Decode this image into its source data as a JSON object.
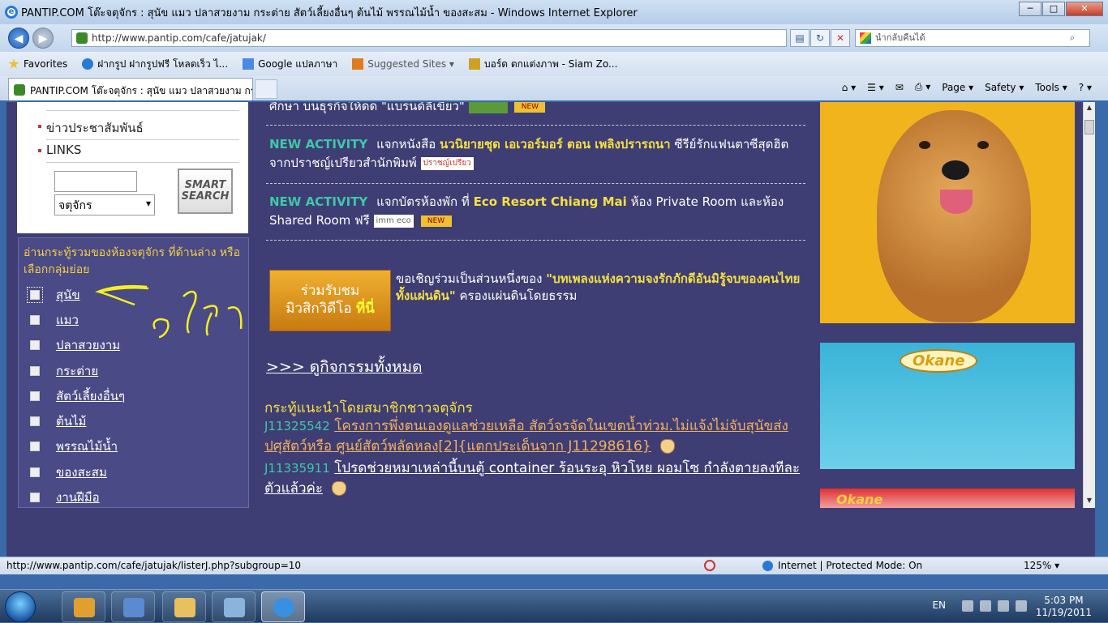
{
  "window": {
    "title": "PANTIP.COM โต๊ะจตุจักร : สุนัข แมว ปลาสวยงาม กระต่าย สัตว์เลี้ยงอื่นๆ ต้นไม้ พรรณไม้น้ำ ของสะสม - Windows Internet Explorer",
    "ie_glyph": "e",
    "minimize_glyph": "─",
    "maximize_glyph": "□",
    "close_glyph": "✕"
  },
  "nav": {
    "back_glyph": "◀",
    "forward_glyph": "▶",
    "url": "http://www.pantip.com/cafe/jatujak/",
    "search_placeholder": "นำกลับคืนได้",
    "compat_glyph": "▤",
    "refresh_glyph": "↻",
    "stop_glyph": "✕",
    "search_glyph": "⌕"
  },
  "favorites_bar": {
    "favorites_label": "Favorites",
    "items": [
      {
        "label": "ฝากรูป ฝากรูปฟรี โหลดเร็ว ไ...",
        "color": "#2a7ad4"
      },
      {
        "label": "Google แปลภาษา",
        "color": "#4a8ae0"
      },
      {
        "label": "Suggested Sites ▾",
        "color": "#e07a20"
      },
      {
        "label": "บอร์ด ตกแต่งภาพ - Siam Zo...",
        "color": "#d0a020"
      }
    ]
  },
  "tab": {
    "label": "PANTIP.COM โต๊ะจตุจักร : สุนัข แมว ปลาสวยงาม กระ..."
  },
  "command_bar": {
    "home": "⌂ ▾",
    "feeds": "☰ ▾",
    "mail": "✉",
    "print": "⎙ ▾",
    "page": "Page ▾",
    "safety": "Safety ▾",
    "tools": "Tools ▾",
    "help": "? ▾"
  },
  "left_panel": {
    "links": [
      "ข่าวประชาสัมพันธ์",
      "LINKS"
    ],
    "search_select": "จตุจักร",
    "smart_search_label": "SMART SEARCH"
  },
  "categories": {
    "heading": "อ่านกระทู้รวมของห้องจตุจักร ที่ด้านล่าง หรือเลือกกลุ่มย่อย",
    "items": [
      "สุนัข",
      "แมว",
      "ปลาสวยงาม",
      "กระต่าย",
      "สัตว์เลี้ยงอื่นๆ",
      "ต้นไม้",
      "พรรณไม้น้ำ",
      "ของสะสม",
      "งานฝีมือ"
    ]
  },
  "activities": {
    "top_partial": "ศึกษา บนธุรกิจให้ดด \"แบรนด์ลีเขียว\"",
    "new_badge": "NEW",
    "items": [
      {
        "label": "NEW ACTIVITY",
        "text_before": "แจกหนังสือ",
        "highlight": "นวนิยายชุด เอเวอร์มอร์ ตอน เพลิงปรารถนา",
        "text_after": "ซีรีย์รักแฟนตาซีสุดฮิต จากปราชญ์เปรียวสำนักพิมพ์",
        "logo": "ปราชญ์เปรียว"
      },
      {
        "label": "NEW ACTIVITY",
        "text_before": "แจกบัตรห้องพัก ที่",
        "highlight": "Eco Resort Chiang Mai",
        "text_after": "ห้อง Private Room และห้อง Shared Room ฟรี",
        "logo": "imm eco"
      }
    ],
    "banner_line1": "ร่วมรับชม",
    "banner_line2": "มิวสิกวิดีโอ",
    "banner_here": "ที่นี่",
    "banner_text_before": "ขอเชิญร่วมเป็นส่วนหนึ่งของ",
    "banner_highlight": "\"บทเพลงแห่งความจงรักภักดีอันมิรู้จบของคนไทยทั้งแผ่นดิน\"",
    "banner_text_after": "ครองแผ่นดินโดยธรรม",
    "all_activities": ">>> ดูกิจกรรมทั้งหมด"
  },
  "recommended": {
    "heading": "กระทู้แนะนำโดยสมาชิกชาวจตุจักร",
    "items": [
      {
        "id": "J11325542",
        "title": "โครงการพึ่งตนเองดูแลช่วยเหลือ สัตว์จรจัดในเขตน้ำท่วม.ไม่แจ้งไม่จับสุนัขส่งปศุสัตว์หรือ ศูนย์สัตว์พลัดหลง[2]{แตกประเด็นจาก J11298616}"
      },
      {
        "id": "J11335911",
        "title": "โปรดช่วยหมาเหล่านี้บนตู้ container ร้อนระอุ หิวโหย ผอมโซ กำลังตายลงทีละตัวแล้วค่ะ"
      }
    ]
  },
  "ads": {
    "brand": "Okane"
  },
  "status": {
    "url": "http://www.pantip.com/cafe/jatujak/listerJ.php?subgroup=10",
    "zone": "Internet | Protected Mode: On",
    "zoom": "125%"
  },
  "taskbar": {
    "language": "EN",
    "time": "5:03 PM",
    "date": "11/19/2011"
  }
}
